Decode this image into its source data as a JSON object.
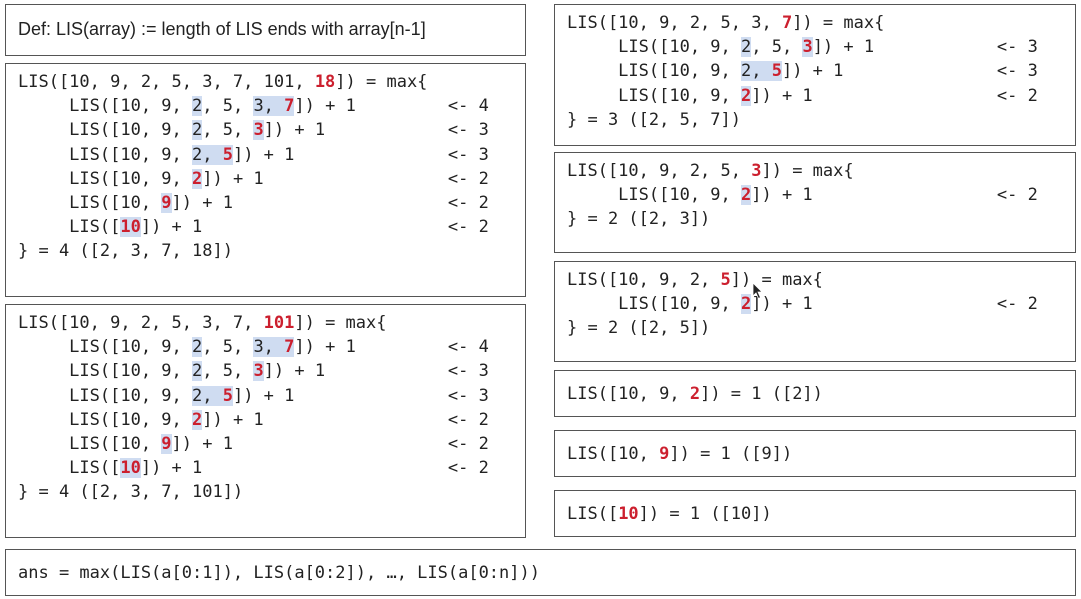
{
  "definition": "Def: LIS(array) := length of LIS ends with array[n-1]",
  "panels": {
    "lis_18": {
      "lines": [
        [
          {
            "t": "LIS([10, 9, 2, 5, 3, 7, 101, "
          },
          {
            "t": "18",
            "s": "red"
          },
          {
            "t": "]) = max{"
          }
        ],
        [
          {
            "t": "     LIS([10, 9, "
          },
          {
            "t": "2",
            "s": "hl"
          },
          {
            "t": ", 5, "
          },
          {
            "t": "3, ",
            "s": "hl"
          },
          {
            "t": "7",
            "s": "hl-red"
          },
          {
            "t": "]) + 1         <- 4"
          }
        ],
        [
          {
            "t": "     LIS([10, 9, "
          },
          {
            "t": "2",
            "s": "hl"
          },
          {
            "t": ", 5, "
          },
          {
            "t": "3",
            "s": "hl-red"
          },
          {
            "t": "]) + 1            <- 3"
          }
        ],
        [
          {
            "t": "     LIS([10, 9, "
          },
          {
            "t": "2, ",
            "s": "hl"
          },
          {
            "t": "5",
            "s": "hl-red"
          },
          {
            "t": "]) + 1               <- 3"
          }
        ],
        [
          {
            "t": "     LIS([10, 9, "
          },
          {
            "t": "2",
            "s": "hl-red"
          },
          {
            "t": "]) + 1                  <- 2"
          }
        ],
        [
          {
            "t": "     LIS([10, "
          },
          {
            "t": "9",
            "s": "hl-red"
          },
          {
            "t": "]) + 1                     <- 2"
          }
        ],
        [
          {
            "t": "     LIS(["
          },
          {
            "t": "10",
            "s": "hl-red"
          },
          {
            "t": "]) + 1                        <- 2"
          }
        ],
        [
          {
            "t": "} = 4 ([2, 3, 7, 18])"
          }
        ]
      ]
    },
    "lis_101": {
      "lines": [
        [
          {
            "t": "LIS([10, 9, 2, 5, 3, 7, "
          },
          {
            "t": "101",
            "s": "red"
          },
          {
            "t": "]) = max{"
          }
        ],
        [
          {
            "t": "     LIS([10, 9, "
          },
          {
            "t": "2",
            "s": "hl"
          },
          {
            "t": ", 5, "
          },
          {
            "t": "3, ",
            "s": "hl"
          },
          {
            "t": "7",
            "s": "hl-red"
          },
          {
            "t": "]) + 1         <- 4"
          }
        ],
        [
          {
            "t": "     LIS([10, 9, "
          },
          {
            "t": "2",
            "s": "hl"
          },
          {
            "t": ", 5, "
          },
          {
            "t": "3",
            "s": "hl-red"
          },
          {
            "t": "]) + 1            <- 3"
          }
        ],
        [
          {
            "t": "     LIS([10, 9, "
          },
          {
            "t": "2, ",
            "s": "hl"
          },
          {
            "t": "5",
            "s": "hl-red"
          },
          {
            "t": "]) + 1               <- 3"
          }
        ],
        [
          {
            "t": "     LIS([10, 9, "
          },
          {
            "t": "2",
            "s": "hl-red"
          },
          {
            "t": "]) + 1                  <- 2"
          }
        ],
        [
          {
            "t": "     LIS([10, "
          },
          {
            "t": "9",
            "s": "hl-red"
          },
          {
            "t": "]) + 1                     <- 2"
          }
        ],
        [
          {
            "t": "     LIS(["
          },
          {
            "t": "10",
            "s": "hl-red"
          },
          {
            "t": "]) + 1                        <- 2"
          }
        ],
        [
          {
            "t": "} = 4 ([2, 3, 7, 101])"
          }
        ]
      ]
    },
    "lis_7": {
      "lines": [
        [
          {
            "t": "LIS([10, 9, 2, 5, 3, "
          },
          {
            "t": "7",
            "s": "red"
          },
          {
            "t": "]) = max{"
          }
        ],
        [
          {
            "t": "     LIS([10, 9, "
          },
          {
            "t": "2",
            "s": "hl"
          },
          {
            "t": ", 5, "
          },
          {
            "t": "3",
            "s": "hl-red"
          },
          {
            "t": "]) + 1            <- 3"
          }
        ],
        [
          {
            "t": "     LIS([10, 9, "
          },
          {
            "t": "2, ",
            "s": "hl"
          },
          {
            "t": "5",
            "s": "hl-red"
          },
          {
            "t": "]) + 1               <- 3"
          }
        ],
        [
          {
            "t": "     LIS([10, 9, "
          },
          {
            "t": "2",
            "s": "hl-red"
          },
          {
            "t": "]) + 1                  <- 2"
          }
        ],
        [
          {
            "t": "} = 3 ([2, 5, 7])"
          }
        ]
      ]
    },
    "lis_3": {
      "lines": [
        [
          {
            "t": "LIS([10, 9, 2, 5, "
          },
          {
            "t": "3",
            "s": "red"
          },
          {
            "t": "]) = max{"
          }
        ],
        [
          {
            "t": "     LIS([10, 9, "
          },
          {
            "t": "2",
            "s": "hl-red"
          },
          {
            "t": "]) + 1                  <- 2"
          }
        ],
        [
          {
            "t": "} = 2 ([2, 3])"
          }
        ]
      ]
    },
    "lis_5": {
      "lines": [
        [
          {
            "t": "LIS([10, 9, 2, "
          },
          {
            "t": "5",
            "s": "red"
          },
          {
            "t": "]) = max{"
          }
        ],
        [
          {
            "t": "     LIS([10, 9, "
          },
          {
            "t": "2",
            "s": "hl-red"
          },
          {
            "t": "]) + 1                  <- 2"
          }
        ],
        [
          {
            "t": "} = 2 ([2, 5])"
          }
        ]
      ]
    },
    "lis_2": {
      "lines": [
        [
          {
            "t": "LIS([10, 9, "
          },
          {
            "t": "2",
            "s": "red"
          },
          {
            "t": "]) = 1 ([2])"
          }
        ]
      ]
    },
    "lis_9": {
      "lines": [
        [
          {
            "t": "LIS([10, "
          },
          {
            "t": "9",
            "s": "red"
          },
          {
            "t": "]) = 1 ([9])"
          }
        ]
      ]
    },
    "lis_10": {
      "lines": [
        [
          {
            "t": "LIS(["
          },
          {
            "t": "10",
            "s": "red"
          },
          {
            "t": "]) = 1 ([10])"
          }
        ]
      ]
    },
    "answer": {
      "lines": [
        [
          {
            "t": "ans = max(LIS(a[0:1]), LIS(a[0:2]), …, LIS(a[0:n]))"
          }
        ]
      ]
    }
  }
}
